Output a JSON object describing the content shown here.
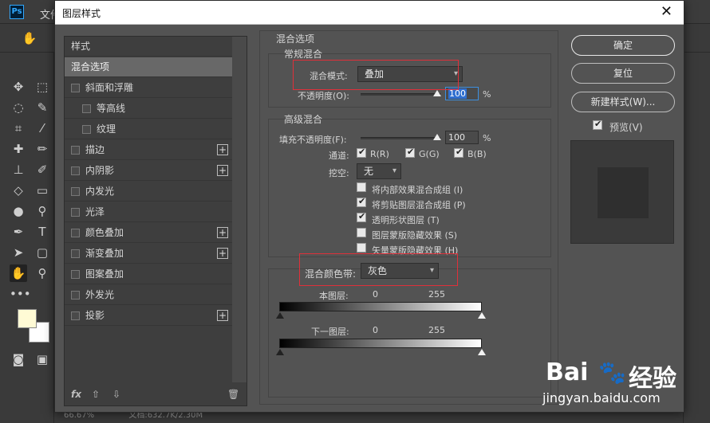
{
  "app": {
    "logo": "Ps",
    "menu_first": "文件"
  },
  "dialog": {
    "title": "图层样式",
    "close_label": "✕"
  },
  "styles_list": {
    "header": "样式",
    "items": [
      {
        "label": "混合选项",
        "checkbox": false,
        "plus": false,
        "selected": true
      },
      {
        "label": "斜面和浮雕",
        "checkbox": true,
        "plus": false
      },
      {
        "label": "等高线",
        "checkbox": true,
        "plus": false,
        "indent": true
      },
      {
        "label": "纹理",
        "checkbox": true,
        "plus": false,
        "indent": true
      },
      {
        "label": "描边",
        "checkbox": true,
        "plus": true
      },
      {
        "label": "内阴影",
        "checkbox": true,
        "plus": true
      },
      {
        "label": "内发光",
        "checkbox": true,
        "plus": false
      },
      {
        "label": "光泽",
        "checkbox": true,
        "plus": false
      },
      {
        "label": "颜色叠加",
        "checkbox": true,
        "plus": true
      },
      {
        "label": "渐变叠加",
        "checkbox": true,
        "plus": true
      },
      {
        "label": "图案叠加",
        "checkbox": true,
        "plus": false
      },
      {
        "label": "外发光",
        "checkbox": true,
        "plus": false
      },
      {
        "label": "投影",
        "checkbox": true,
        "plus": true
      }
    ],
    "footer": {
      "fx": "fx",
      "up": "⇧",
      "down": "⇩",
      "trash": "🗑"
    }
  },
  "blend_options": {
    "section_title": "混合选项",
    "general": {
      "title": "常规混合",
      "blend_mode_label": "混合模式:",
      "blend_mode_value": "叠加",
      "opacity_label": "不透明度(O):",
      "opacity_value": "100",
      "opacity_unit": "%"
    },
    "advanced": {
      "title": "高级混合",
      "fill_opacity_label": "填充不透明度(F):",
      "fill_opacity_value": "100",
      "fill_opacity_unit": "%",
      "channels_label": "通道:",
      "channels": [
        {
          "label": "R(R)",
          "checked": true
        },
        {
          "label": "G(G)",
          "checked": true
        },
        {
          "label": "B(B)",
          "checked": true
        }
      ],
      "knockout_label": "挖空:",
      "knockout_value": "无",
      "options": [
        {
          "label": "将内部效果混合成组 (I)",
          "checked": false
        },
        {
          "label": "将剪贴图层混合成组 (P)",
          "checked": true
        },
        {
          "label": "透明形状图层 (T)",
          "checked": true
        },
        {
          "label": "图层蒙版隐藏效果 (S)",
          "checked": false
        },
        {
          "label": "矢量蒙版隐藏效果 (H)",
          "checked": false
        }
      ]
    },
    "blend_if": {
      "label": "混合颜色带:",
      "value": "灰色",
      "this_layer_label": "本图层:",
      "this_layer_min": "0",
      "this_layer_max": "255",
      "underlying_label": "下一图层:",
      "underlying_min": "0",
      "underlying_max": "255"
    }
  },
  "buttons": {
    "ok": "确定",
    "reset": "复位",
    "new_style": "新建样式(W)...",
    "preview_label": "预览(V)",
    "preview_checked": true
  },
  "status_bar": {
    "zoom": "66.67%",
    "doc": "文档:632.7K/2.30M"
  },
  "watermark": {
    "brand": "Bai",
    "paw": "🐾",
    "suffix": "经验",
    "url": "jingyan.baidu.com"
  }
}
